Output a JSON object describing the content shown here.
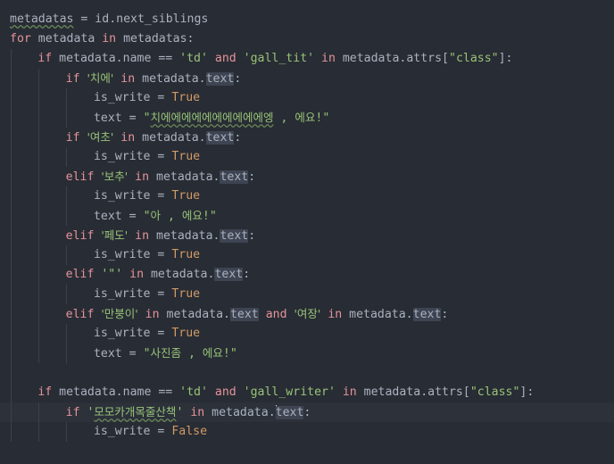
{
  "editor": {
    "language": "python",
    "theme_name": "one-dark",
    "colors": {
      "background": "#282c34",
      "current_line": "#2c313a",
      "foreground": "#abb2bf",
      "string": "#98c379",
      "keyword": "#e5939b",
      "literal": "#d19a66",
      "occurrence_highlight": "#3e4451",
      "indent_guide": "#3b414d",
      "spellcheck_squiggle": "#6a8759",
      "caret": "#d7dae0"
    },
    "caret": {
      "line_index": 18,
      "column": 32,
      "before_token": "text"
    }
  },
  "lines": [
    {
      "indent": 0,
      "guides": 0,
      "current": false,
      "tokens": [
        {
          "t": "metadatas",
          "c": "plain spell"
        },
        {
          "t": " = ",
          "c": "punc"
        },
        {
          "t": "id",
          "c": "plain"
        },
        {
          "t": ".",
          "c": "punc"
        },
        {
          "t": "next_siblings",
          "c": "plain"
        }
      ]
    },
    {
      "indent": 0,
      "guides": 0,
      "current": false,
      "tokens": [
        {
          "t": "for",
          "c": "kw-ctrl"
        },
        {
          "t": " metadata ",
          "c": "plain"
        },
        {
          "t": "in",
          "c": "kw-ctrl"
        },
        {
          "t": " metadatas",
          "c": "plain"
        },
        {
          "t": ":",
          "c": "punc"
        }
      ]
    },
    {
      "indent": 1,
      "guides": 1,
      "current": false,
      "tokens": [
        {
          "t": "if",
          "c": "kw-ctrl"
        },
        {
          "t": " metadata",
          "c": "plain"
        },
        {
          "t": ".",
          "c": "punc"
        },
        {
          "t": "name ",
          "c": "plain"
        },
        {
          "t": "==",
          "c": "punc"
        },
        {
          "t": " ",
          "c": "plain"
        },
        {
          "t": "'td'",
          "c": "str"
        },
        {
          "t": " ",
          "c": "plain"
        },
        {
          "t": "and",
          "c": "kw-ctrl"
        },
        {
          "t": " ",
          "c": "plain"
        },
        {
          "t": "'gall_tit'",
          "c": "str"
        },
        {
          "t": " ",
          "c": "plain"
        },
        {
          "t": "in",
          "c": "kw-ctrl"
        },
        {
          "t": " metadata",
          "c": "plain"
        },
        {
          "t": ".",
          "c": "punc"
        },
        {
          "t": "attrs",
          "c": "plain"
        },
        {
          "t": "[",
          "c": "punc"
        },
        {
          "t": "\"class\"",
          "c": "str"
        },
        {
          "t": "]",
          "c": "punc"
        },
        {
          "t": ":",
          "c": "punc"
        }
      ]
    },
    {
      "indent": 2,
      "guides": 2,
      "current": false,
      "tokens": [
        {
          "t": "if",
          "c": "kw-ctrl"
        },
        {
          "t": " ",
          "c": "plain"
        },
        {
          "t": "'치에'",
          "c": "str hangul"
        },
        {
          "t": " ",
          "c": "plain"
        },
        {
          "t": "in",
          "c": "kw-ctrl"
        },
        {
          "t": " metadata",
          "c": "plain"
        },
        {
          "t": ".",
          "c": "punc"
        },
        {
          "t": "text",
          "c": "plain occ"
        },
        {
          "t": ":",
          "c": "punc"
        }
      ]
    },
    {
      "indent": 3,
      "guides": 3,
      "current": false,
      "tokens": [
        {
          "t": "is_write ",
          "c": "plain"
        },
        {
          "t": "=",
          "c": "punc"
        },
        {
          "t": " ",
          "c": "plain"
        },
        {
          "t": "True",
          "c": "lit"
        }
      ]
    },
    {
      "indent": 3,
      "guides": 3,
      "current": false,
      "tokens": [
        {
          "t": "text ",
          "c": "plain"
        },
        {
          "t": "=",
          "c": "punc"
        },
        {
          "t": " ",
          "c": "plain"
        },
        {
          "t": "\"",
          "c": "str"
        },
        {
          "t": "치에에에에에에에에에에엥",
          "c": "str hangul spell"
        },
        {
          "t": " , ",
          "c": "str"
        },
        {
          "t": "에요",
          "c": "str hangul"
        },
        {
          "t": "!\"",
          "c": "str"
        }
      ]
    },
    {
      "indent": 2,
      "guides": 2,
      "current": false,
      "tokens": [
        {
          "t": "if",
          "c": "kw-ctrl"
        },
        {
          "t": " ",
          "c": "plain"
        },
        {
          "t": "'여초'",
          "c": "str hangul"
        },
        {
          "t": " ",
          "c": "plain"
        },
        {
          "t": "in",
          "c": "kw-ctrl"
        },
        {
          "t": " metadata",
          "c": "plain"
        },
        {
          "t": ".",
          "c": "punc"
        },
        {
          "t": "text",
          "c": "plain occ"
        },
        {
          "t": ":",
          "c": "punc"
        }
      ]
    },
    {
      "indent": 3,
      "guides": 3,
      "current": false,
      "tokens": [
        {
          "t": "is_write ",
          "c": "plain"
        },
        {
          "t": "=",
          "c": "punc"
        },
        {
          "t": " ",
          "c": "plain"
        },
        {
          "t": "True",
          "c": "lit"
        }
      ]
    },
    {
      "indent": 2,
      "guides": 2,
      "current": false,
      "tokens": [
        {
          "t": "elif",
          "c": "kw-ctrl"
        },
        {
          "t": " ",
          "c": "plain"
        },
        {
          "t": "'보추'",
          "c": "str hangul"
        },
        {
          "t": " ",
          "c": "plain"
        },
        {
          "t": "in",
          "c": "kw-ctrl"
        },
        {
          "t": " metadata",
          "c": "plain"
        },
        {
          "t": ".",
          "c": "punc"
        },
        {
          "t": "text",
          "c": "plain occ"
        },
        {
          "t": ":",
          "c": "punc"
        }
      ]
    },
    {
      "indent": 3,
      "guides": 3,
      "current": false,
      "tokens": [
        {
          "t": "is_write ",
          "c": "plain"
        },
        {
          "t": "=",
          "c": "punc"
        },
        {
          "t": " ",
          "c": "plain"
        },
        {
          "t": "True",
          "c": "lit"
        }
      ]
    },
    {
      "indent": 3,
      "guides": 3,
      "current": false,
      "tokens": [
        {
          "t": "text ",
          "c": "plain"
        },
        {
          "t": "=",
          "c": "punc"
        },
        {
          "t": " ",
          "c": "plain"
        },
        {
          "t": "\"",
          "c": "str"
        },
        {
          "t": "아",
          "c": "str hangul"
        },
        {
          "t": " , ",
          "c": "str"
        },
        {
          "t": "에요",
          "c": "str hangul"
        },
        {
          "t": "!\"",
          "c": "str"
        }
      ]
    },
    {
      "indent": 2,
      "guides": 2,
      "current": false,
      "tokens": [
        {
          "t": "elif",
          "c": "kw-ctrl"
        },
        {
          "t": " ",
          "c": "plain"
        },
        {
          "t": "'페도'",
          "c": "str hangul"
        },
        {
          "t": " ",
          "c": "plain"
        },
        {
          "t": "in",
          "c": "kw-ctrl"
        },
        {
          "t": " metadata",
          "c": "plain"
        },
        {
          "t": ".",
          "c": "punc"
        },
        {
          "t": "text",
          "c": "plain occ"
        },
        {
          "t": ":",
          "c": "punc"
        }
      ]
    },
    {
      "indent": 3,
      "guides": 3,
      "current": false,
      "tokens": [
        {
          "t": "is_write ",
          "c": "plain"
        },
        {
          "t": "=",
          "c": "punc"
        },
        {
          "t": " ",
          "c": "plain"
        },
        {
          "t": "True",
          "c": "lit"
        }
      ]
    },
    {
      "indent": 2,
      "guides": 2,
      "current": false,
      "tokens": [
        {
          "t": "elif",
          "c": "kw-ctrl"
        },
        {
          "t": " ",
          "c": "plain"
        },
        {
          "t": "'\"'",
          "c": "str"
        },
        {
          "t": " ",
          "c": "plain"
        },
        {
          "t": "in",
          "c": "kw-ctrl"
        },
        {
          "t": " metadata",
          "c": "plain"
        },
        {
          "t": ".",
          "c": "punc"
        },
        {
          "t": "text",
          "c": "plain occ"
        },
        {
          "t": ":",
          "c": "punc"
        }
      ]
    },
    {
      "indent": 3,
      "guides": 3,
      "current": false,
      "tokens": [
        {
          "t": "is_write ",
          "c": "plain"
        },
        {
          "t": "=",
          "c": "punc"
        },
        {
          "t": " ",
          "c": "plain"
        },
        {
          "t": "True",
          "c": "lit"
        }
      ]
    },
    {
      "indent": 2,
      "guides": 2,
      "current": false,
      "tokens": [
        {
          "t": "elif",
          "c": "kw-ctrl"
        },
        {
          "t": " ",
          "c": "plain"
        },
        {
          "t": "'만붕이'",
          "c": "str hangul"
        },
        {
          "t": " ",
          "c": "plain"
        },
        {
          "t": "in",
          "c": "kw-ctrl"
        },
        {
          "t": " metadata",
          "c": "plain"
        },
        {
          "t": ".",
          "c": "punc"
        },
        {
          "t": "text",
          "c": "plain occ"
        },
        {
          "t": " ",
          "c": "plain"
        },
        {
          "t": "and",
          "c": "kw-ctrl"
        },
        {
          "t": " ",
          "c": "plain"
        },
        {
          "t": "'여장'",
          "c": "str hangul"
        },
        {
          "t": " ",
          "c": "plain"
        },
        {
          "t": "in",
          "c": "kw-ctrl"
        },
        {
          "t": " metadata",
          "c": "plain"
        },
        {
          "t": ".",
          "c": "punc"
        },
        {
          "t": "text",
          "c": "plain occ"
        },
        {
          "t": ":",
          "c": "punc"
        }
      ]
    },
    {
      "indent": 3,
      "guides": 3,
      "current": false,
      "tokens": [
        {
          "t": "is_write ",
          "c": "plain"
        },
        {
          "t": "=",
          "c": "punc"
        },
        {
          "t": " ",
          "c": "plain"
        },
        {
          "t": "True",
          "c": "lit"
        }
      ]
    },
    {
      "indent": 3,
      "guides": 3,
      "current": false,
      "tokens": [
        {
          "t": "text ",
          "c": "plain"
        },
        {
          "t": "=",
          "c": "punc"
        },
        {
          "t": " ",
          "c": "plain"
        },
        {
          "t": "\"",
          "c": "str"
        },
        {
          "t": "사진좀",
          "c": "str hangul"
        },
        {
          "t": " , ",
          "c": "str"
        },
        {
          "t": "에요",
          "c": "str hangul"
        },
        {
          "t": "!\"",
          "c": "str"
        }
      ]
    },
    {
      "indent": 0,
      "guides": 1,
      "current": false,
      "tokens": []
    },
    {
      "indent": 1,
      "guides": 1,
      "current": false,
      "tokens": [
        {
          "t": "if",
          "c": "kw-ctrl"
        },
        {
          "t": " metadata",
          "c": "plain"
        },
        {
          "t": ".",
          "c": "punc"
        },
        {
          "t": "name ",
          "c": "plain"
        },
        {
          "t": "==",
          "c": "punc"
        },
        {
          "t": " ",
          "c": "plain"
        },
        {
          "t": "'td'",
          "c": "str"
        },
        {
          "t": " ",
          "c": "plain"
        },
        {
          "t": "and",
          "c": "kw-ctrl"
        },
        {
          "t": " ",
          "c": "plain"
        },
        {
          "t": "'gall_writer'",
          "c": "str"
        },
        {
          "t": " ",
          "c": "plain"
        },
        {
          "t": "in",
          "c": "kw-ctrl"
        },
        {
          "t": " metadata",
          "c": "plain"
        },
        {
          "t": ".",
          "c": "punc"
        },
        {
          "t": "attrs",
          "c": "plain"
        },
        {
          "t": "[",
          "c": "punc"
        },
        {
          "t": "\"class\"",
          "c": "str"
        },
        {
          "t": "]",
          "c": "punc"
        },
        {
          "t": ":",
          "c": "punc"
        }
      ]
    },
    {
      "indent": 2,
      "guides": 2,
      "current": true,
      "tokens": [
        {
          "t": "if",
          "c": "kw-ctrl"
        },
        {
          "t": " ",
          "c": "plain"
        },
        {
          "t": "'",
          "c": "str"
        },
        {
          "t": "모모카개목줄산책",
          "c": "str hangul spell"
        },
        {
          "t": "'",
          "c": "str"
        },
        {
          "t": " ",
          "c": "plain"
        },
        {
          "t": "in",
          "c": "kw-ctrl"
        },
        {
          "t": " metadata",
          "c": "plain"
        },
        {
          "t": ".",
          "c": "punc"
        },
        {
          "t": "",
          "c": "caret-mark"
        },
        {
          "t": "text",
          "c": "plain occ"
        },
        {
          "t": ":",
          "c": "punc"
        }
      ]
    },
    {
      "indent": 3,
      "guides": 3,
      "current": false,
      "tokens": [
        {
          "t": "is_write ",
          "c": "plain"
        },
        {
          "t": "=",
          "c": "punc"
        },
        {
          "t": " ",
          "c": "plain"
        },
        {
          "t": "False",
          "c": "lit"
        }
      ]
    }
  ]
}
